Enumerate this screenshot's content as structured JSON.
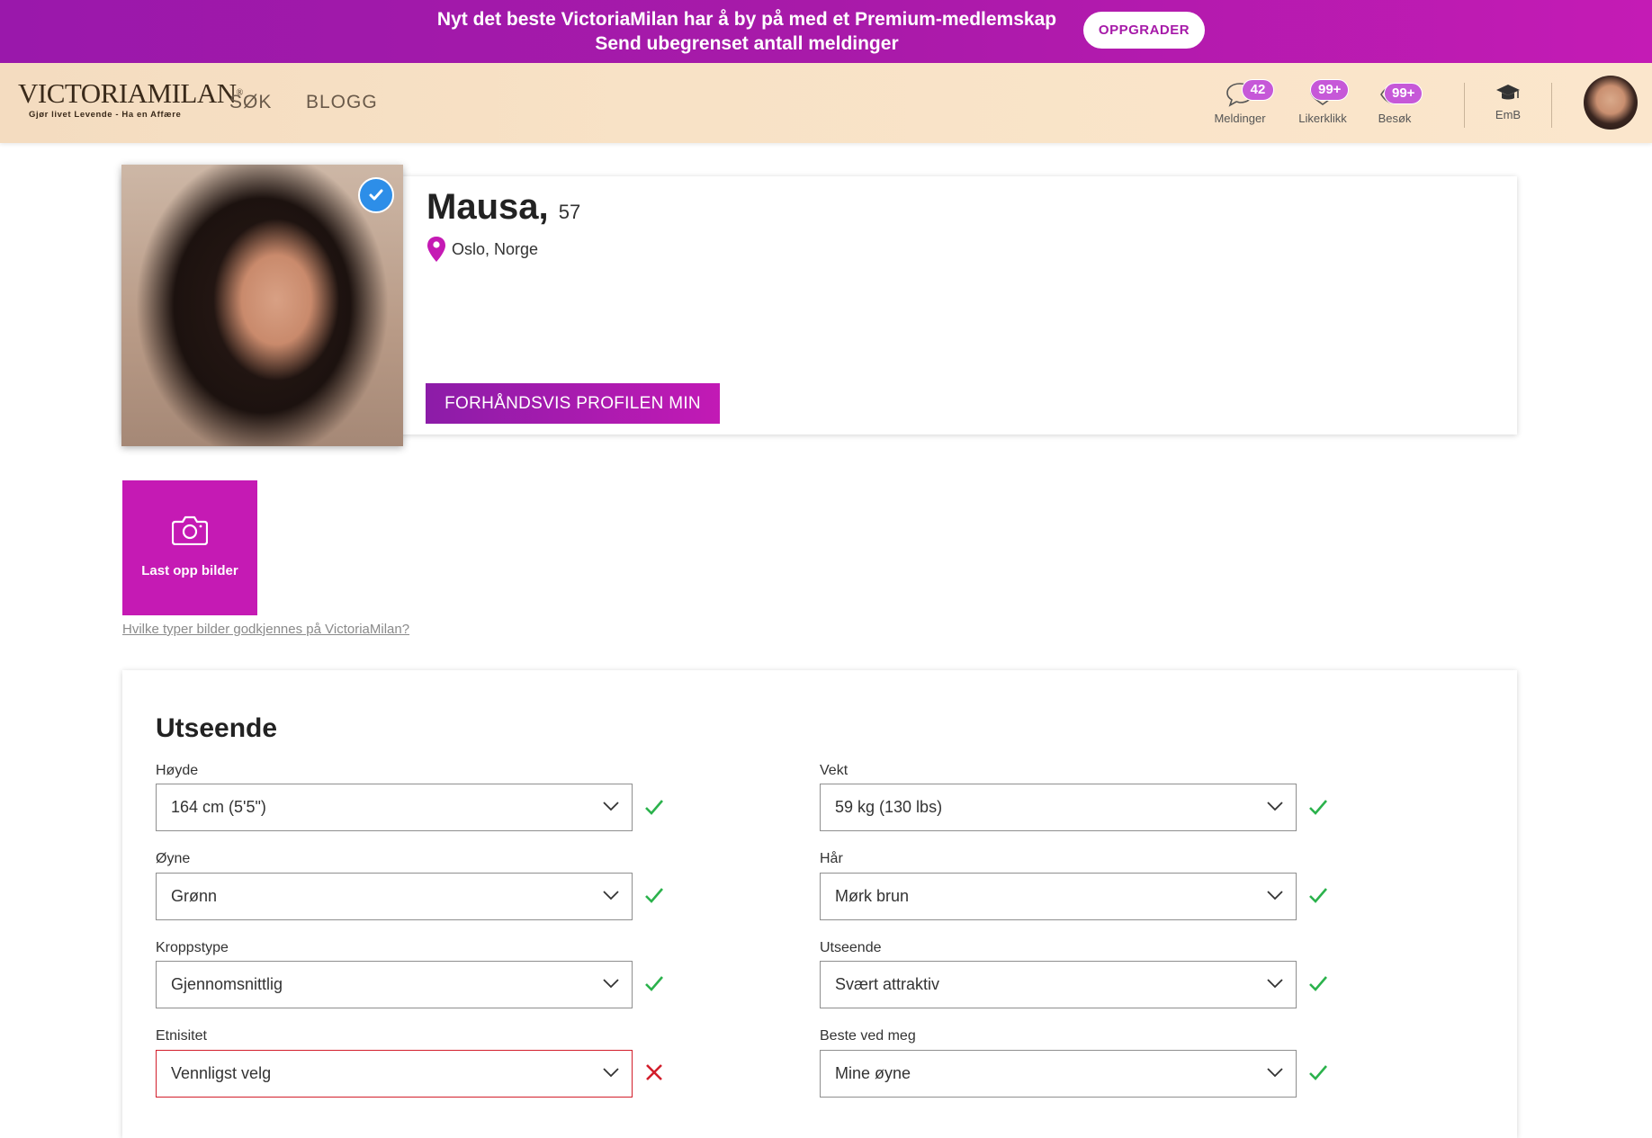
{
  "promo": {
    "line1": "Nyt det beste VictoriaMilan har å by på med et Premium-medlemskap",
    "line2": "Send ubegrenset antall meldinger",
    "upgrade_label": "OPPGRADER"
  },
  "header": {
    "logo_text": "VICTORIAMILAN",
    "logo_tagline": "Gjør livet Levende - Ha en Affære",
    "nav": [
      "SØK",
      "BLOGG"
    ],
    "messages": {
      "label": "Meldinger",
      "count": "42"
    },
    "likes": {
      "label": "Likerklikk",
      "count": "99+"
    },
    "visits": {
      "label": "Besøk",
      "count": "99+"
    },
    "academy": {
      "label": "EmB"
    }
  },
  "profile": {
    "name": "Mausa,",
    "age": "57",
    "location": "Oslo, Norge",
    "preview_label": "FORHÅNDSVIS PROFILEN MIN"
  },
  "upload": {
    "label": "Last opp bilder",
    "help_link": "Hvilke typer bilder godkjennes på VictoriaMilan?"
  },
  "appearance": {
    "title": "Utseende",
    "fields": [
      {
        "label": "Høyde",
        "value": "164 cm (5'5\")",
        "status": "ok"
      },
      {
        "label": "Vekt",
        "value": "59 kg (130 lbs)",
        "status": "ok"
      },
      {
        "label": "Øyne",
        "value": "Grønn",
        "status": "ok"
      },
      {
        "label": "Hår",
        "value": "Mørk brun",
        "status": "ok"
      },
      {
        "label": "Kroppstype",
        "value": "Gjennomsnittlig",
        "status": "ok"
      },
      {
        "label": "Utseende",
        "value": "Svært attraktiv",
        "status": "ok"
      },
      {
        "label": "Etnisitet",
        "value": "Vennligst velg",
        "status": "error"
      },
      {
        "label": "Beste ved meg",
        "value": "Mine øyne",
        "status": "ok"
      }
    ]
  },
  "colors": {
    "brand_purple": "#a61aa8",
    "accent_magenta": "#c51ab4",
    "ok_green": "#2bb24c",
    "error_red": "#d21e2b"
  }
}
